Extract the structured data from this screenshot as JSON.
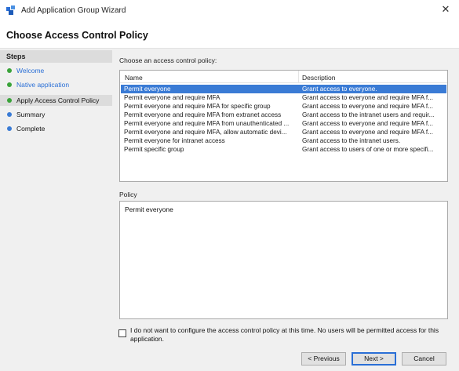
{
  "window": {
    "title": "Add Application Group Wizard",
    "close_glyph": "✕"
  },
  "header": {
    "page_title": "Choose Access Control Policy"
  },
  "steps": {
    "heading": "Steps",
    "items": [
      {
        "label": "Welcome",
        "state": "done",
        "dot_color": "#3aa33a"
      },
      {
        "label": "Native application",
        "state": "done",
        "dot_color": "#3aa33a"
      },
      {
        "label": "Apply Access Control Policy",
        "state": "current",
        "dot_color": "#3aa33a"
      },
      {
        "label": "Summary",
        "state": "pending",
        "dot_color": "#3a7bd5"
      },
      {
        "label": "Complete",
        "state": "pending",
        "dot_color": "#3a7bd5"
      }
    ]
  },
  "policy_list": {
    "label": "Choose an access control policy:",
    "columns": [
      "Name",
      "Description"
    ],
    "rows": [
      {
        "name": "Permit everyone",
        "description": "Grant access to everyone.",
        "selected": true
      },
      {
        "name": "Permit everyone and require MFA",
        "description": "Grant access to everyone and require MFA f...",
        "selected": false
      },
      {
        "name": "Permit everyone and require MFA for specific group",
        "description": "Grant access to everyone and require MFA f...",
        "selected": false
      },
      {
        "name": "Permit everyone and require MFA from extranet access",
        "description": "Grant access to the intranet users and requir...",
        "selected": false
      },
      {
        "name": "Permit everyone and require MFA from unauthenticated ...",
        "description": "Grant access to everyone and require MFA f...",
        "selected": false
      },
      {
        "name": "Permit everyone and require MFA, allow automatic devi...",
        "description": "Grant access to everyone and require MFA f...",
        "selected": false
      },
      {
        "name": "Permit everyone for intranet access",
        "description": "Grant access to the intranet users.",
        "selected": false
      },
      {
        "name": "Permit specific group",
        "description": "Grant access to users of one or more specifi...",
        "selected": false
      }
    ]
  },
  "policy": {
    "label": "Policy",
    "text": "Permit everyone"
  },
  "opt_out": {
    "checked": false,
    "label": "I do not want to configure the access control policy at this time.  No users will be permitted access for this application."
  },
  "buttons": {
    "previous": "< Previous",
    "next": "Next >",
    "cancel": "Cancel"
  },
  "colors": {
    "selection": "#3a7bd5",
    "link": "#2a6fd6",
    "done": "#3aa33a",
    "pending": "#3a7bd5"
  }
}
